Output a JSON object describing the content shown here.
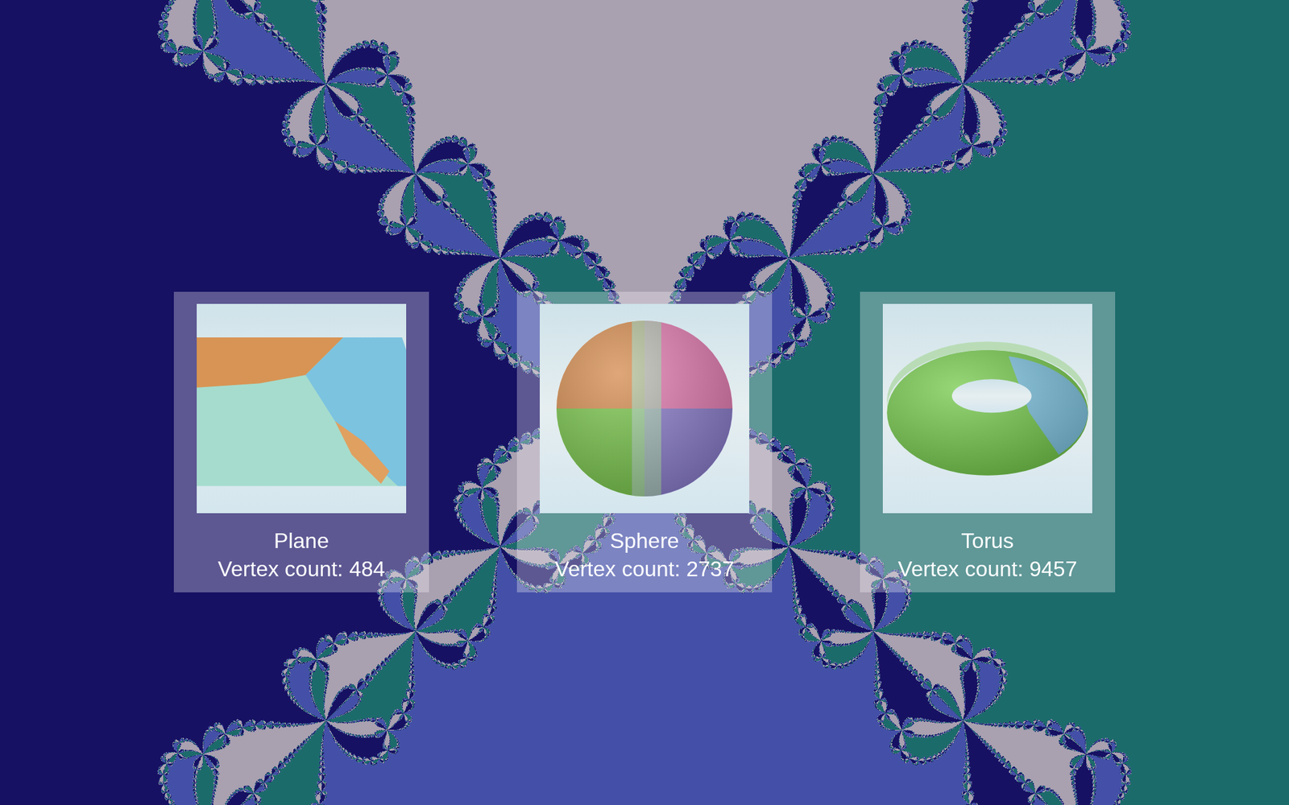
{
  "cards": [
    {
      "title": "Plane",
      "vertex_count": "Vertex count: 484",
      "kind": "plane"
    },
    {
      "title": "Sphere",
      "vertex_count": "Vertex count: 2737",
      "kind": "sphere"
    },
    {
      "title": "Torus",
      "vertex_count": "Vertex count: 9457",
      "kind": "torus"
    }
  ]
}
